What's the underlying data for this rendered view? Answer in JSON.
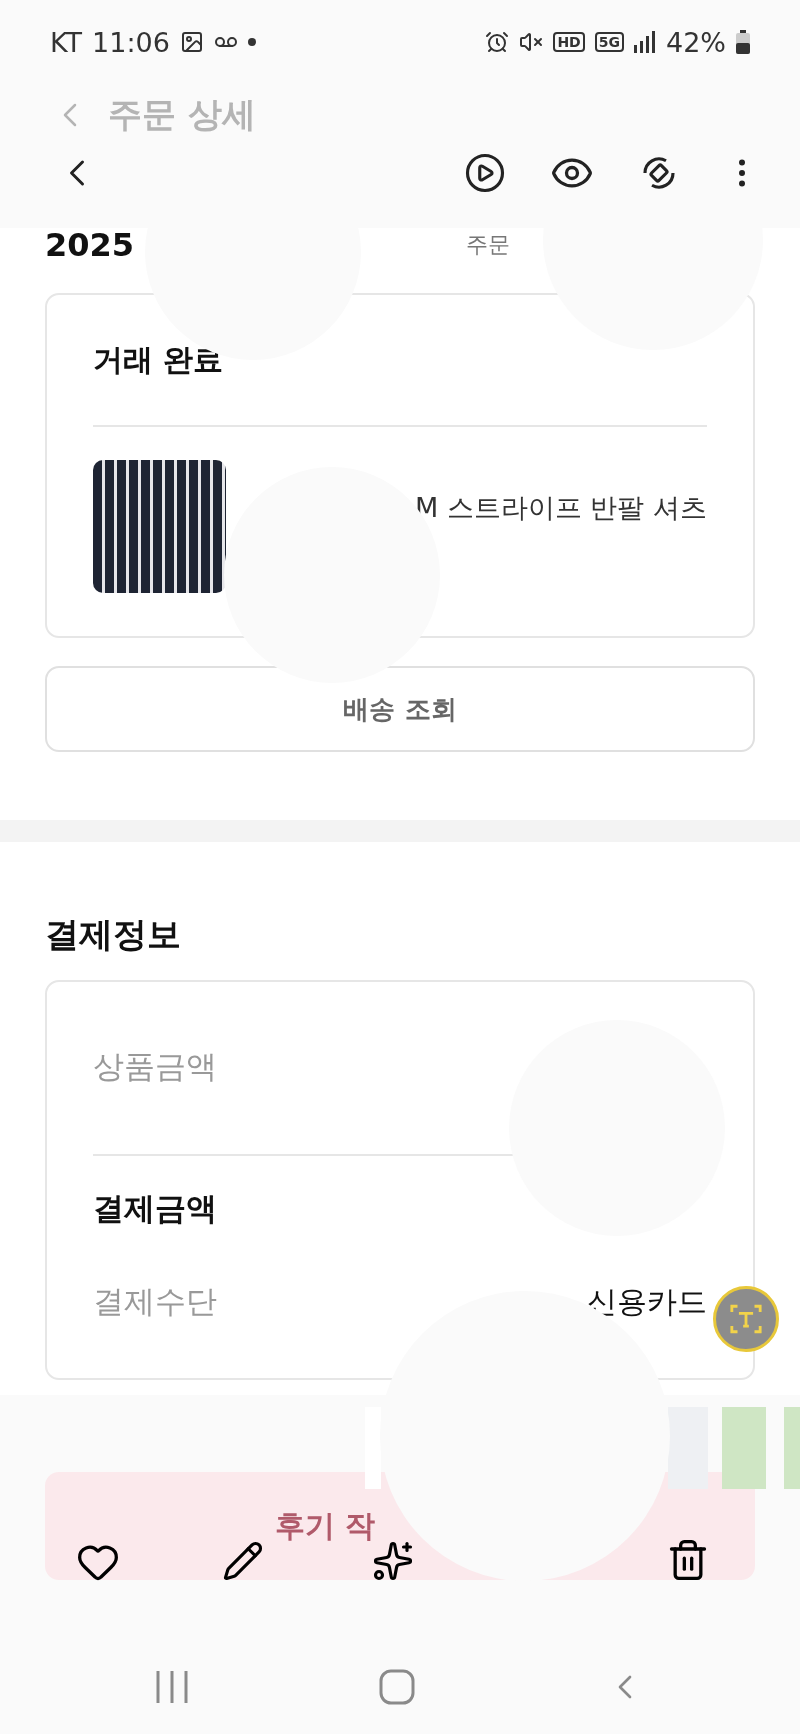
{
  "status_bar": {
    "carrier": "KT",
    "time": "11:06",
    "hd": "HD",
    "network": "5G",
    "battery": "42%"
  },
  "faded_header": {
    "title": "주문 상세"
  },
  "order": {
    "year": "2025",
    "column_2": "주문",
    "status": "거래 완료",
    "product_title": "M 스트라이프 반팔 셔츠",
    "track_button": "배송 조회"
  },
  "payment": {
    "title": "결제정보",
    "rows": [
      {
        "label": "상품금액",
        "kind": "muted"
      },
      {
        "label": "결제금액",
        "kind": "bold"
      },
      {
        "label": "결제수단",
        "kind": "muted",
        "value": "신용카드"
      }
    ]
  },
  "review_button": "후기 작"
}
